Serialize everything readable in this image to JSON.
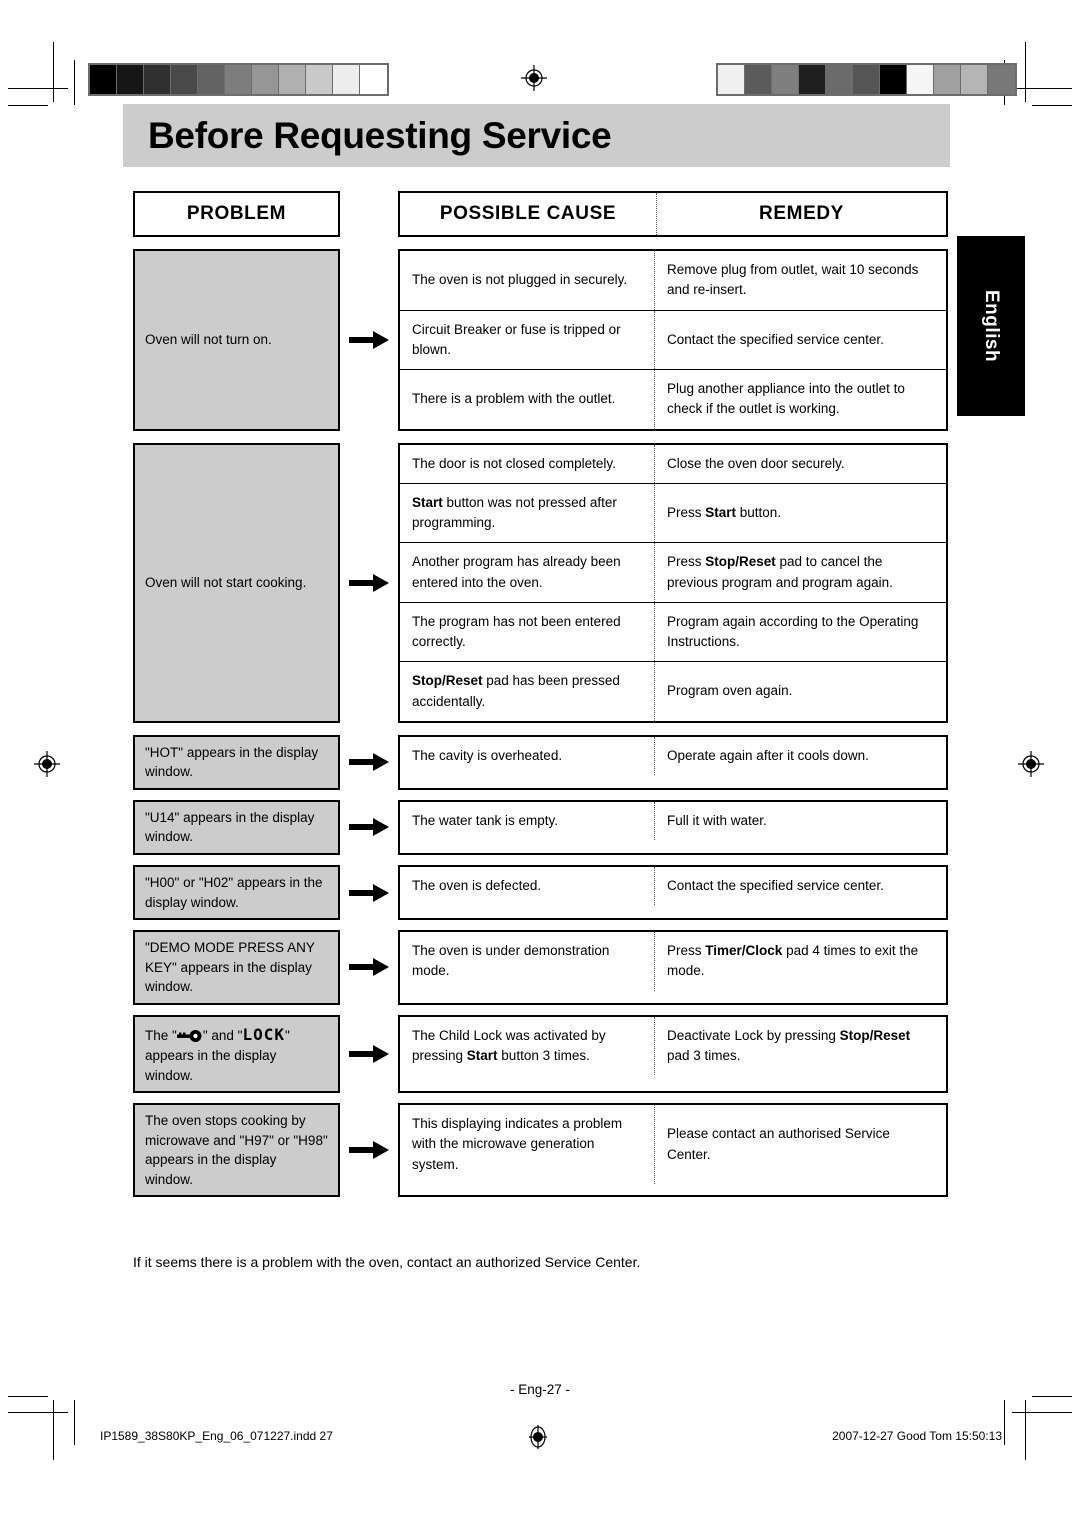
{
  "page": {
    "title": "Before Requesting Service",
    "side_tab": "English",
    "footnote": "If it seems there is a problem with the oven, contact an authorized Service Center.",
    "page_number": "- Eng-27 -",
    "file_label": "IP1589_38S80KP_Eng_06_071227.indd   27",
    "time_label": "2007-12-27   Good Tom 15:50:13"
  },
  "headers": {
    "problem": "PROBLEM",
    "cause": "POSSIBLE CAUSE",
    "remedy": "REMEDY"
  },
  "colors": {
    "title_band": "#cccccc",
    "problem_cell": "#cccccc",
    "tab_background": "#000000",
    "tab_text": "#ffffff"
  },
  "stepwedge_left": [
    "#000000",
    "#161616",
    "#303030",
    "#4a4a4a",
    "#636363",
    "#7d7d7d",
    "#969696",
    "#b0b0b0",
    "#c9c9c9",
    "#ededed",
    "#ffffff"
  ],
  "stepwedge_right": [
    "#f0f0f0",
    "#5b5b5b",
    "#7f7f7f",
    "#1e1e1e",
    "#6b6b6b",
    "#555555",
    "#000000",
    "#f5f5f5",
    "#a0a0a0",
    "#b5b5b5",
    "#787878"
  ],
  "groups": [
    {
      "problem": "Oven will not turn on.",
      "rows": [
        {
          "cause": "The oven is not plugged in securely.",
          "remedy": "Remove plug from outlet, wait 10 seconds and re-insert."
        },
        {
          "cause": "Circuit Breaker or fuse is tripped or blown.",
          "remedy": "Contact the specified service center."
        },
        {
          "cause": "There is a problem with the outlet.",
          "remedy": "Plug another appliance into the outlet to check if the outlet is working."
        }
      ]
    },
    {
      "problem": "Oven will not start cooking.",
      "rows": [
        {
          "cause": "The door is not closed completely.",
          "remedy": "Close the oven door securely."
        },
        {
          "cause_bold": "Start",
          "cause_rest": " button was not pressed after programming.",
          "remedy_pre": "Press ",
          "remedy_bold": "Start",
          "remedy_post": " button."
        },
        {
          "cause": "Another program has already been entered into the oven.",
          "remedy_pre": "Press ",
          "remedy_bold": "Stop/Reset",
          "remedy_post": " pad to cancel the previous program and program again."
        },
        {
          "cause": "The program has not been entered correctly.",
          "remedy": "Program again according to the Operating Instructions."
        },
        {
          "cause_bold": "Stop/Reset",
          "cause_rest": " pad has been pressed accidentally.",
          "remedy": "Program oven again."
        }
      ]
    },
    {
      "problem": "\"HOT\" appears in the display window.",
      "rows": [
        {
          "cause": "The cavity is overheated.",
          "remedy": "Operate again after it cools down."
        }
      ]
    },
    {
      "problem": "\"U14\" appears in the display window.",
      "rows": [
        {
          "cause": "The water tank is empty.",
          "remedy": "Full it with water."
        }
      ]
    },
    {
      "problem": "\"H00\" or \"H02\" appears in the display window.",
      "rows": [
        {
          "cause": "The oven is defected.",
          "remedy": "Contact the specified service center."
        }
      ]
    },
    {
      "problem": "\"DEMO MODE PRESS ANY KEY\" appears in the display window.",
      "rows": [
        {
          "cause": "The oven is under demonstration mode.",
          "remedy_pre": "Press ",
          "remedy_bold": "Timer/Clock",
          "remedy_post": " pad 4 times to exit the mode."
        }
      ]
    },
    {
      "problem_pre": "The \"",
      "problem_icon": "key-icon",
      "problem_mid": "\" and \"",
      "problem_seg": "LOCK",
      "problem_post": "\" appears in the display window.",
      "rows": [
        {
          "cause_pre": "The Child Lock was activated by pressing ",
          "cause_bold": "Start",
          "cause_post": " button 3 times.",
          "remedy_pre": "Deactivate Lock by pressing ",
          "remedy_bold": "Stop/Reset",
          "remedy_post": " pad 3 times."
        }
      ]
    },
    {
      "problem": "The oven stops cooking by microwave and \"H97\" or \"H98\" appears in the display window.",
      "rows": [
        {
          "cause": "This displaying indicates a problem with the microwave generation system.",
          "remedy": "Please contact an authorised Service Center."
        }
      ]
    }
  ]
}
